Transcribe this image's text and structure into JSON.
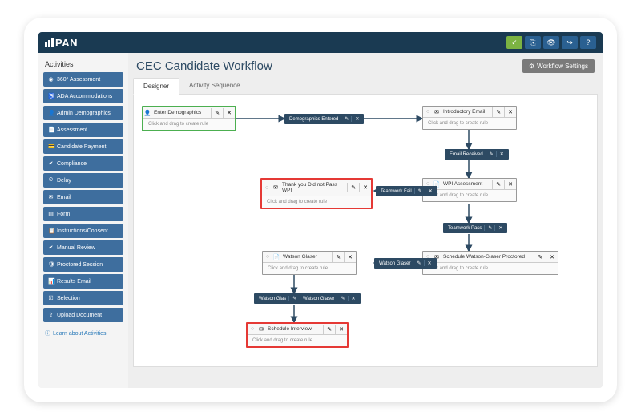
{
  "logo": "PAN",
  "topbar_actions": [
    "✓",
    "⎘",
    "👁",
    "↪",
    "?"
  ],
  "sidebar": {
    "title": "Activities",
    "items": [
      {
        "icon": "◉",
        "label": "360° Assessment"
      },
      {
        "icon": "♿",
        "label": "ADA Accommodations"
      },
      {
        "icon": "👤",
        "label": "Admin Demographics"
      },
      {
        "icon": "📄",
        "label": "Assessment"
      },
      {
        "icon": "💳",
        "label": "Candidate Payment"
      },
      {
        "icon": "✔",
        "label": "Compliance"
      },
      {
        "icon": "⏲",
        "label": "Delay"
      },
      {
        "icon": "✉",
        "label": "Email"
      },
      {
        "icon": "▤",
        "label": "Form"
      },
      {
        "icon": "📋",
        "label": "Instructions/Consent"
      },
      {
        "icon": "✔",
        "label": "Manual Review"
      },
      {
        "icon": "🛡",
        "label": "Proctored Session"
      },
      {
        "icon": "📊",
        "label": "Results Email"
      },
      {
        "icon": "☑",
        "label": "Selection"
      },
      {
        "icon": "⇪",
        "label": "Upload Document"
      }
    ],
    "learn_link": "Learn about Activities"
  },
  "page": {
    "title": "CEC Candidate Workflow",
    "settings_btn": "Workflow Settings",
    "tabs": [
      {
        "label": "Designer",
        "active": true
      },
      {
        "label": "Activity Sequence",
        "active": false
      }
    ]
  },
  "nodes": {
    "drag_text": "Click and drag to create rule",
    "edit": "✎",
    "close": "✕",
    "n1": {
      "title": "Enter Demographics",
      "icon": "👤"
    },
    "n2": {
      "title": "Introductory Email",
      "icon": "✉"
    },
    "n3": {
      "title": "Thank you Did not Pass WPI",
      "icon": "✉"
    },
    "n4": {
      "title": "WPI Assessment",
      "icon": "📄"
    },
    "n5": {
      "title": "Watson Glaser",
      "icon": "📄"
    },
    "n6": {
      "title": "Schedule Watson-Glaser Proctored",
      "icon": "✉"
    },
    "n7": {
      "title": "Schedule Interview",
      "icon": "✉"
    }
  },
  "connectors": {
    "c1": "Demographics Entered",
    "c2": "Email Received",
    "c3": "Teamwork Fail",
    "c4": "Teamwork Pass",
    "c5": "Watson Glaser",
    "c6": "Watson Glas",
    "c7": "Watson Glaser"
  }
}
